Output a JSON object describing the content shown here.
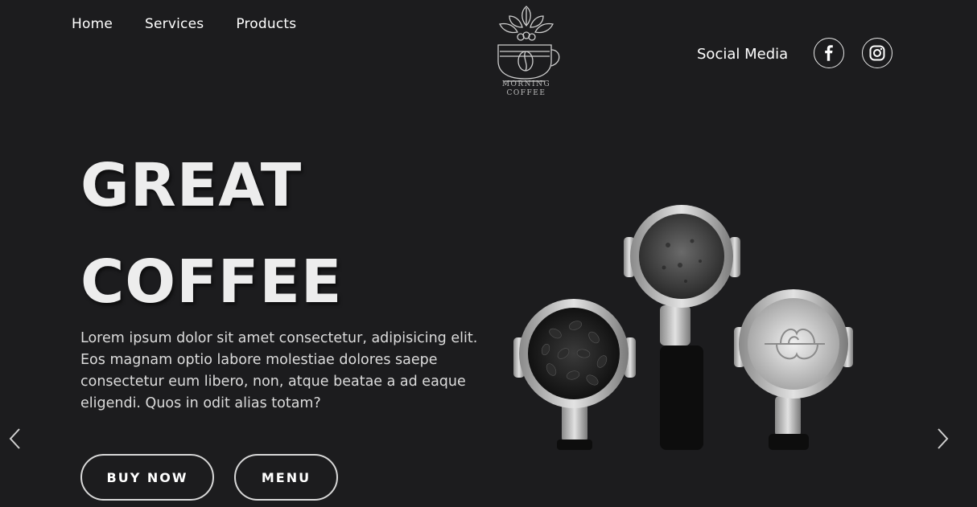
{
  "nav": {
    "items": [
      {
        "label": "Home"
      },
      {
        "label": "Services"
      },
      {
        "label": "Products"
      }
    ]
  },
  "logo": {
    "line1": "MORNING",
    "line2": "COFFEE"
  },
  "social": {
    "label": "Social Media",
    "icons": [
      "facebook-icon",
      "instagram-icon"
    ]
  },
  "hero": {
    "headline_line1": "GREAT",
    "headline_line2": "COFFEE",
    "description": "Lorem ipsum dolor sit amet consectetur, adipisicing elit. Eos magnam optio labore molestiae dolores saepe consectetur eum libero, non, atque beatae a ad eaque eligendi. Quos in odit alias totam?",
    "buttons": {
      "buy": "BUY NOW",
      "menu": "MENU"
    }
  },
  "slider": {
    "prev_icon": "chevron-left-icon",
    "next_icon": "chevron-right-icon"
  },
  "colors": {
    "background": "#1c1c1e",
    "text": "#f2f2f2"
  }
}
